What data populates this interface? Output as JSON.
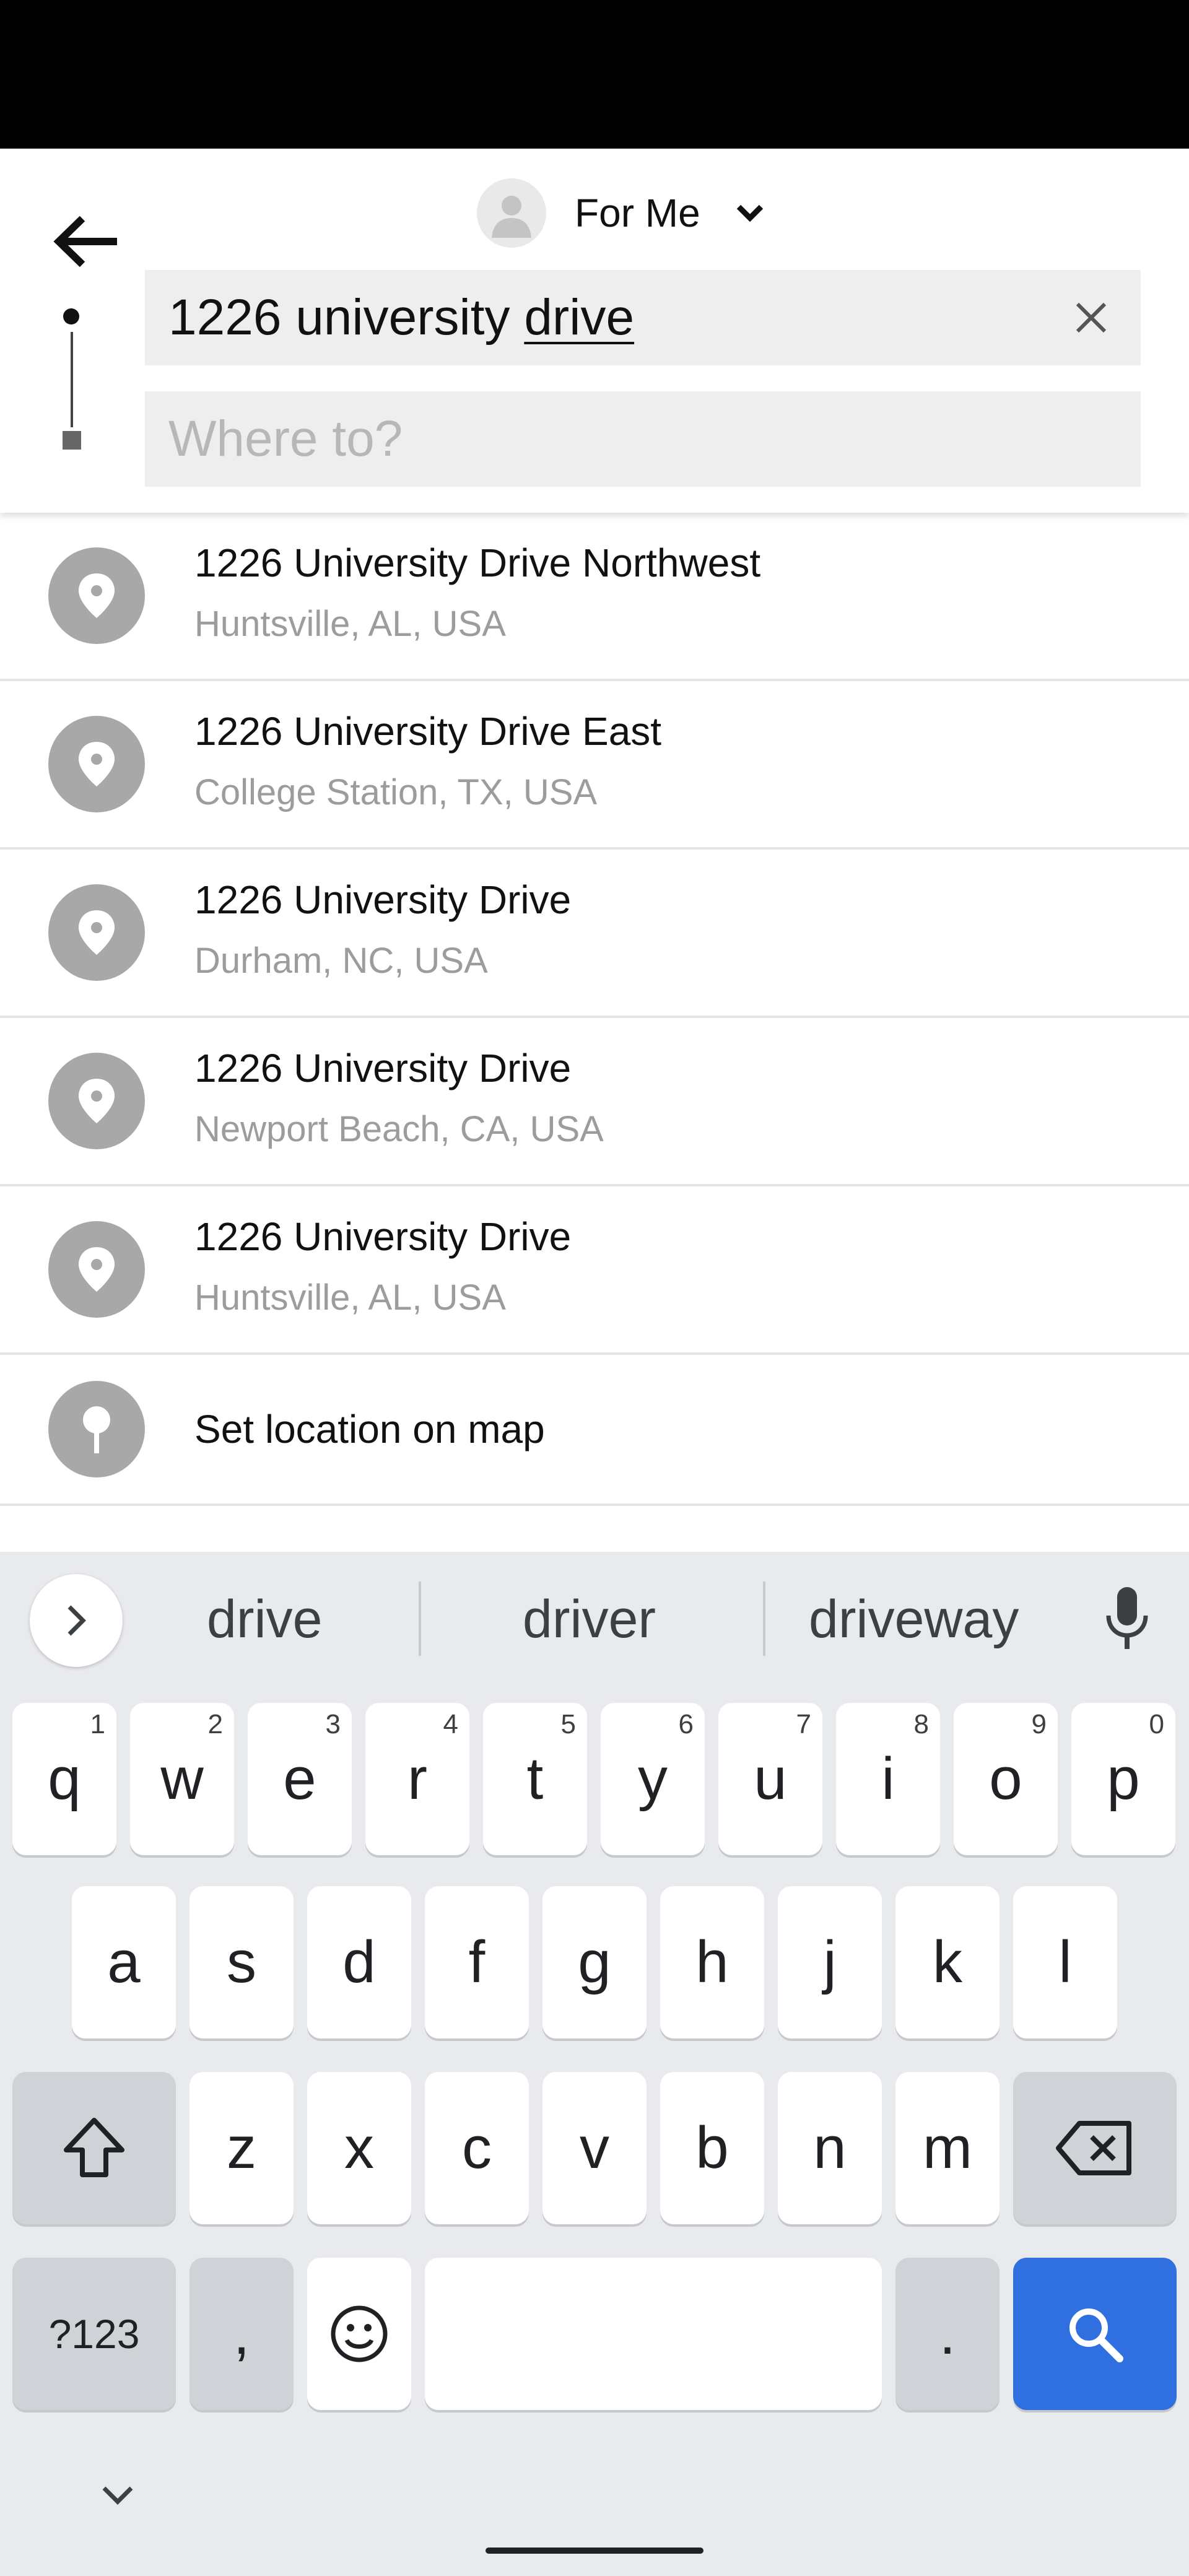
{
  "header": {
    "rider_label": "For Me",
    "pickup_value_plain": "1226 university ",
    "pickup_value_underlined": "drive",
    "destination_placeholder": "Where to?"
  },
  "suggestions": [
    {
      "title": "1226 University Drive Northwest",
      "subtitle": "Huntsville, AL, USA"
    },
    {
      "title": "1226 University Drive East",
      "subtitle": "College Station, TX, USA"
    },
    {
      "title": "1226 University Drive",
      "subtitle": "Durham, NC, USA"
    },
    {
      "title": "1226 University Drive",
      "subtitle": "Newport Beach, CA, USA"
    },
    {
      "title": "1226 University Drive",
      "subtitle": "Huntsville, AL, USA"
    }
  ],
  "set_location": {
    "label": "Set location on map"
  },
  "keyboard": {
    "suggestions": [
      "drive",
      "driver",
      "driveway"
    ],
    "row1": [
      "q",
      "w",
      "e",
      "r",
      "t",
      "y",
      "u",
      "i",
      "o",
      "p"
    ],
    "row1_hints": [
      "1",
      "2",
      "3",
      "4",
      "5",
      "6",
      "7",
      "8",
      "9",
      "0"
    ],
    "row2": [
      "a",
      "s",
      "d",
      "f",
      "g",
      "h",
      "j",
      "k",
      "l"
    ],
    "row3": [
      "z",
      "x",
      "c",
      "v",
      "b",
      "n",
      "m"
    ],
    "symbols_label": "?123",
    "comma_label": ",",
    "period_label": "."
  },
  "colors": {
    "accent": "#2f6fe0",
    "pin": "#a8a8a8",
    "field_bg": "#eeeeee",
    "keyboard_bg": "#e8eaed"
  },
  "icons": [
    "back-arrow-icon",
    "user-icon",
    "chevron-down-icon",
    "clear-icon",
    "location-pin-icon",
    "chevron-right-icon",
    "mic-icon",
    "shift-icon",
    "backspace-icon",
    "emoji-icon",
    "search-icon",
    "keyboard-hide-icon"
  ]
}
